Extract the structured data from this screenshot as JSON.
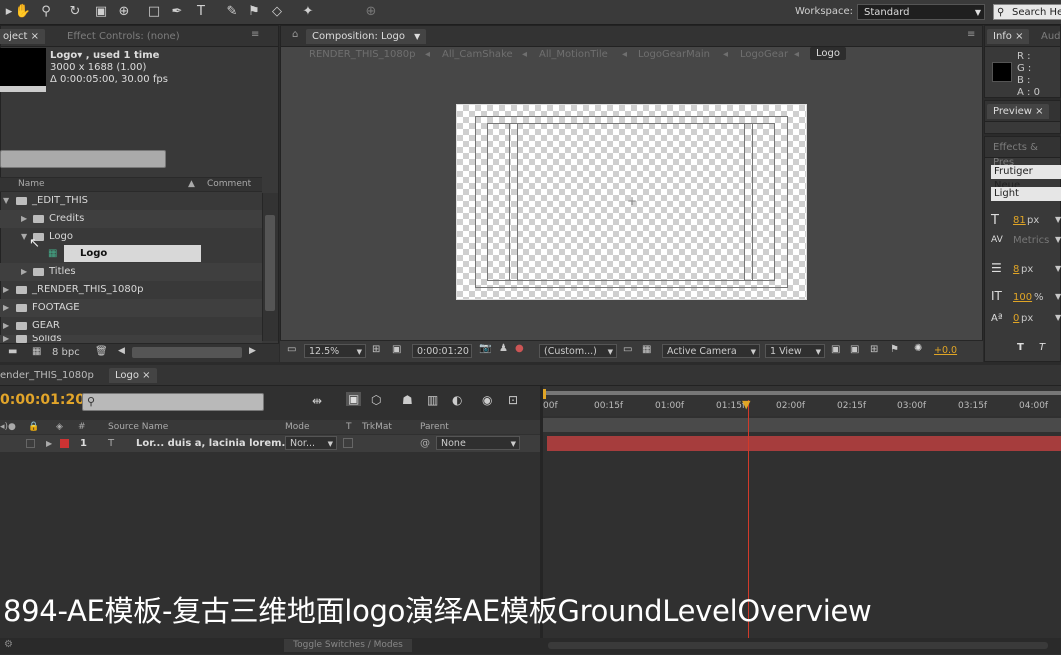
{
  "toolbar": {
    "workspace_label": "Workspace:",
    "workspace_value": "Standard",
    "search_placeholder": "Search He"
  },
  "project_panel": {
    "tabs": [
      "oject ×",
      "Effect Controls: (none)"
    ],
    "item_name": "Logo▾ , used 1 time",
    "dimensions": "3000 x 1688 (1.00)",
    "duration": "Δ 0:00:05:00, 30.00 fps",
    "columns": [
      "Name",
      "Comment"
    ],
    "items": [
      {
        "label": "_EDIT_THIS"
      },
      {
        "label": "Credits"
      },
      {
        "label": "Logo"
      },
      {
        "label": "Logo"
      },
      {
        "label": "Titles"
      },
      {
        "label": "_RENDER_THIS_1080p"
      },
      {
        "label": "FOOTAGE"
      },
      {
        "label": "GEAR"
      },
      {
        "label": "Solids"
      }
    ],
    "bpc": "8 bpc"
  },
  "composition": {
    "tab_label": "Composition: Logo",
    "breadcrumbs": [
      "RENDER_THIS_1080p",
      "All_CamShake",
      "All_MotionTile",
      "LogoGearMain",
      "LogoGear",
      "Logo"
    ],
    "zoom": "12.5%",
    "timecode": "0:00:01:20",
    "resolution": "(Custom...)",
    "camera": "Active Camera",
    "view": "1 View",
    "exposure": "+0.0"
  },
  "info_panel": {
    "tabs": [
      "Info ×",
      "Audi"
    ],
    "r": "R :",
    "g": "G :",
    "b": "B :",
    "a": "A : 0"
  },
  "preview_panel": {
    "tab": "Preview ×"
  },
  "effects_panel": {
    "tab": "Effects & Pres",
    "font": "Frutiger Neue",
    "style": "Light",
    "size": "81",
    "size_unit": "px",
    "kerning": "Metrics",
    "leading": "8",
    "leading_unit": "px",
    "scale": "100",
    "scale_unit": "%",
    "baseline": "0",
    "baseline_unit": "px"
  },
  "timeline": {
    "tabs": [
      "ender_THIS_1080p",
      "Logo ×"
    ],
    "timecode": "0:00:01:20",
    "columns": [
      "#",
      "Source Name",
      "Mode",
      "T",
      "TrkMat",
      "Parent"
    ],
    "ruler_ticks": [
      ":00f",
      "00:15f",
      "01:00f",
      "01:15f",
      "02:00f",
      "02:15f",
      "03:00f",
      "03:15f",
      "04:00f"
    ],
    "layer": {
      "number": "1",
      "name": "Lor... duis a, lacinia lorem.",
      "mode": "Nor...",
      "parent": "None"
    },
    "footer_label": "Toggle Switches / Modes"
  },
  "caption": "894-AE模板-复古三维地面logo演绎AE模板GroundLevelOverview"
}
